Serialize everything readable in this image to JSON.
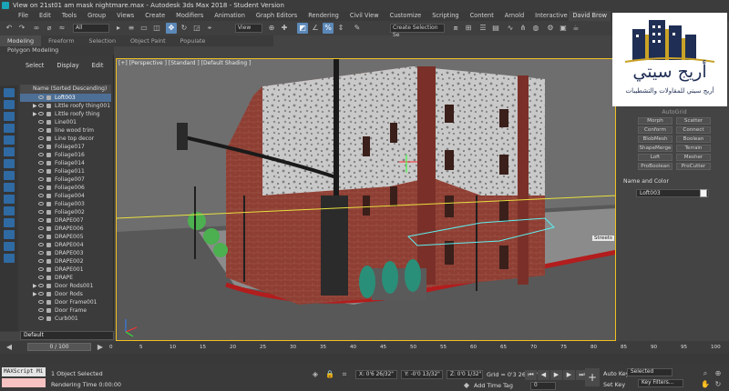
{
  "window": {
    "title": "View on 21st01 am mask nightmare.max - Autodesk 3ds Max 2018 - Student Version"
  },
  "menubar": {
    "items": [
      "File",
      "Edit",
      "Tools",
      "Group",
      "Views",
      "Create",
      "Modifiers",
      "Animation",
      "Graph Editors",
      "Rendering",
      "Civil View",
      "Customize",
      "Scripting",
      "Content",
      "Arnold",
      "Interactive",
      "Help"
    ],
    "user": "David Brow"
  },
  "toolbar": {
    "filter_value": "All",
    "view_value": "View",
    "selection_set_placeholder": "Create Selection Se"
  },
  "ribbon": {
    "tabs": [
      "Modeling",
      "Freeform",
      "Selection",
      "Object Paint",
      "Populate"
    ],
    "sub": "Polygon Modeling"
  },
  "explorer": {
    "tabs": [
      "Select",
      "Display",
      "Edit"
    ],
    "header": "Name (Sorted Descending)",
    "items": [
      {
        "label": "Loft003",
        "sel": true
      },
      {
        "label": "Little roofy thing001",
        "arrow": true
      },
      {
        "label": "Little roofy thing",
        "arrow": true
      },
      {
        "label": "Line001"
      },
      {
        "label": "line wood trim"
      },
      {
        "label": "Line top decor"
      },
      {
        "label": "Foliage017"
      },
      {
        "label": "Foliage016"
      },
      {
        "label": "Foliage014"
      },
      {
        "label": "Foliage011"
      },
      {
        "label": "Foliage007"
      },
      {
        "label": "Foliage006"
      },
      {
        "label": "Foliage004"
      },
      {
        "label": "Foliage003"
      },
      {
        "label": "Foliage002"
      },
      {
        "label": "DRAPE007"
      },
      {
        "label": "DRAPE006"
      },
      {
        "label": "DRAPE005"
      },
      {
        "label": "DRAPE004"
      },
      {
        "label": "DRAPE003"
      },
      {
        "label": "DRAPE002"
      },
      {
        "label": "DRAPE001"
      },
      {
        "label": "DRAPE"
      },
      {
        "label": "Door Rods001",
        "arrow": true
      },
      {
        "label": "Door Rods",
        "arrow": true
      },
      {
        "label": "Door Frame001"
      },
      {
        "label": "Door Frame"
      },
      {
        "label": "Curb001"
      }
    ],
    "layer": "Default"
  },
  "viewport": {
    "label": "[+] [Perspective ] [Standard ] [Default Shading ]",
    "tag": "Streets"
  },
  "command_panel": {
    "rollout_title": "AutoGrid",
    "buttons": [
      "Morph",
      "Scatter",
      "Conform",
      "Connect",
      "BlobMesh",
      "Boolean",
      "ShapeMerge",
      "Terrain",
      "Loft",
      "Mesher",
      "ProBoolean",
      "ProCutter"
    ],
    "name_color_title": "Name and Color",
    "object_name": "Loft003"
  },
  "logo": {
    "arabic_name": "أريج سيتي",
    "arabic_tagline": "أريج سيتي للمقاولات والتشطيبات"
  },
  "timeline": {
    "slider": "0 / 100",
    "ticks": [
      "0",
      "5",
      "10",
      "15",
      "20",
      "25",
      "30",
      "35",
      "40",
      "45",
      "50",
      "55",
      "60",
      "65",
      "70",
      "75",
      "80",
      "85",
      "90",
      "95",
      "100"
    ]
  },
  "status": {
    "maxscript": "MAXScript Mi",
    "selected": "1 Object Selected",
    "rendering_time": "Rendering Time  0:00:00",
    "x": "X: 0'6 26/32\"",
    "y": "Y: -0'0 13/32\"",
    "z": "Z: 0'0 1/32\"",
    "grid": "Grid = 0'3 26/32\"",
    "add_time_tag": "Add Time Tag",
    "auto_key": "Auto Key",
    "set_key": "Set Key",
    "selected_dropdown": "Selected",
    "key_filters": "Key Filters...",
    "frame": "0"
  }
}
